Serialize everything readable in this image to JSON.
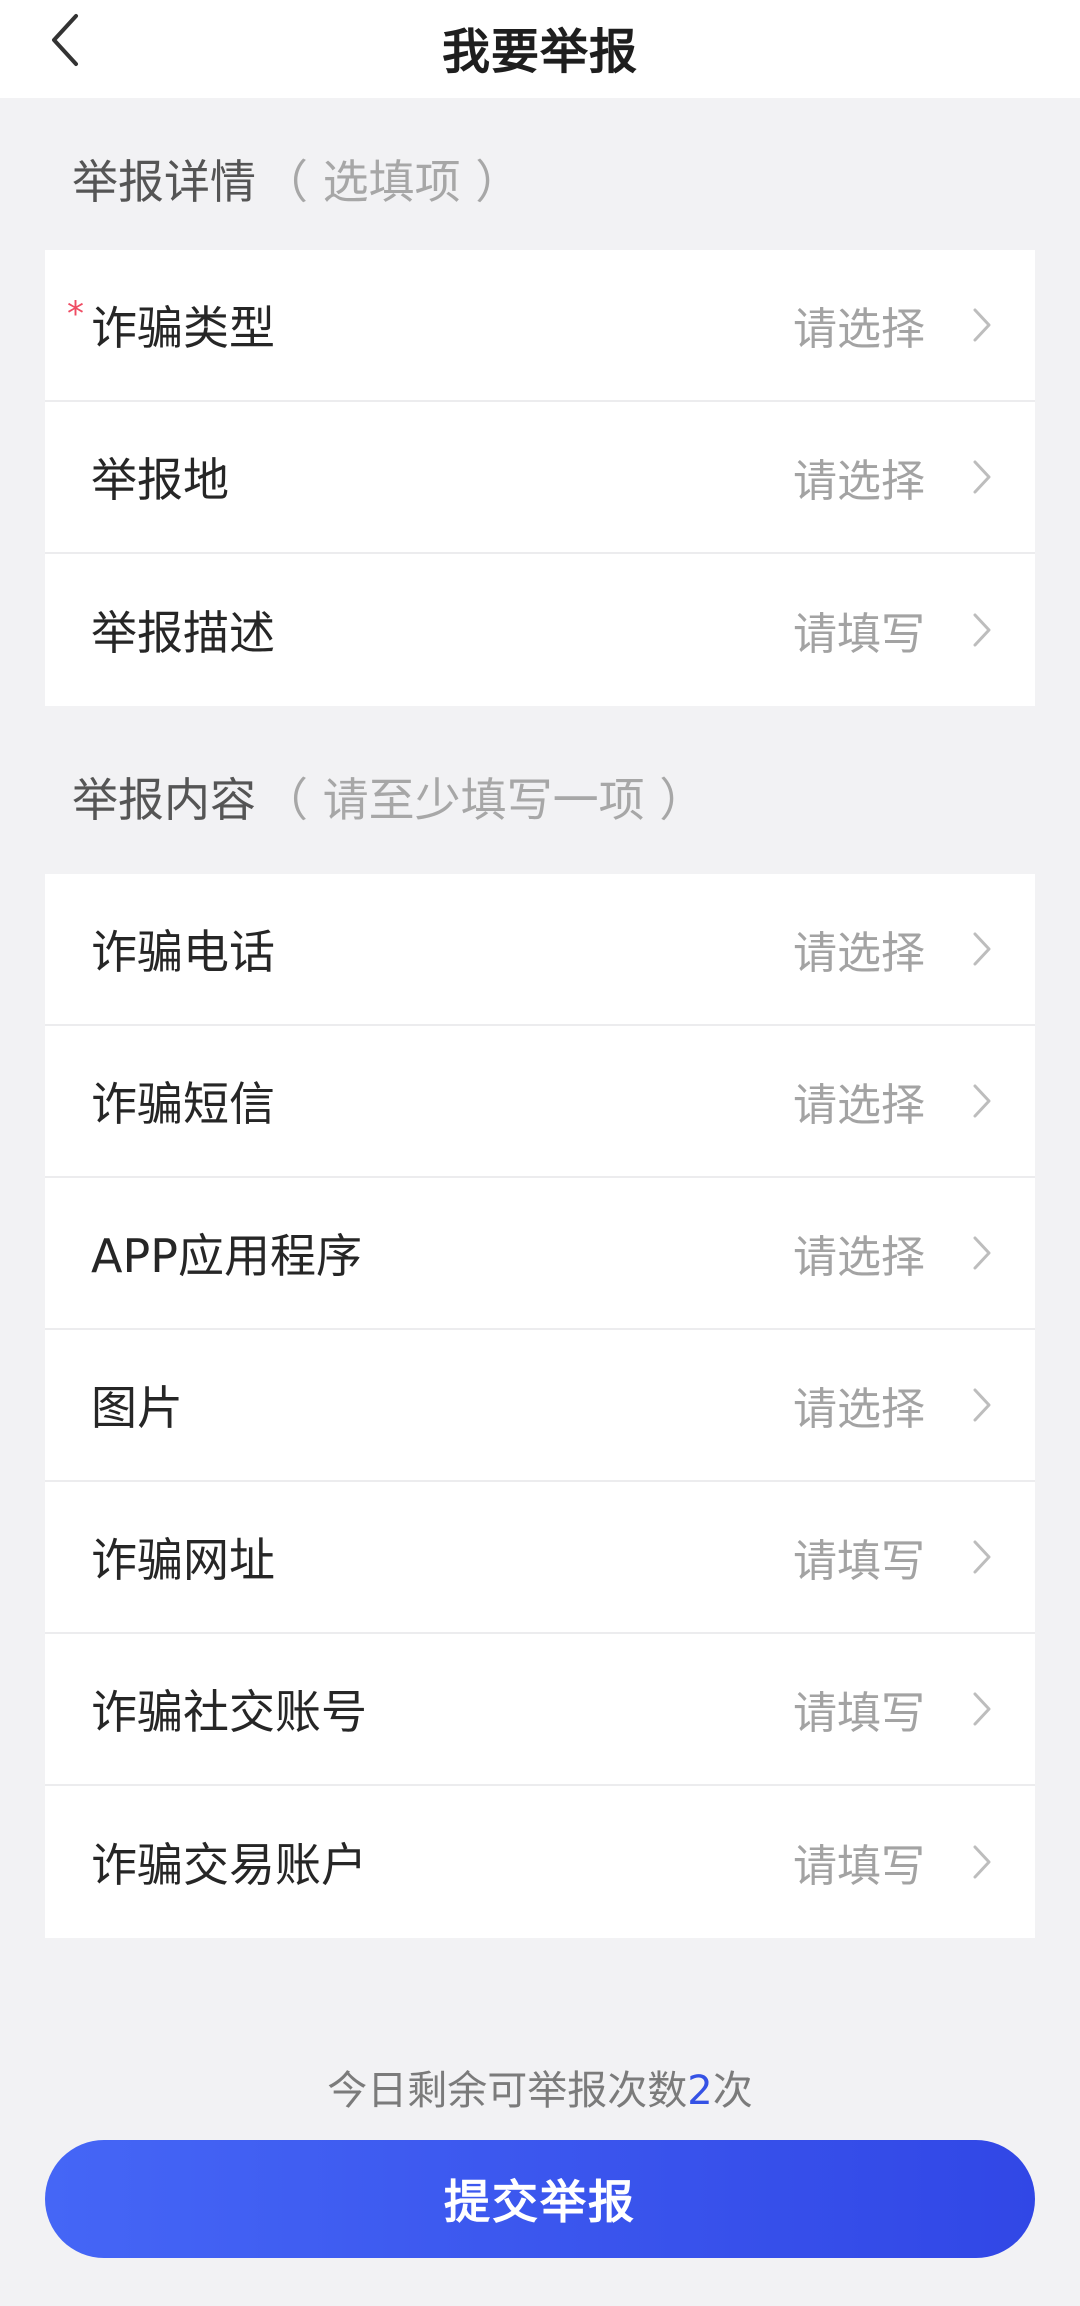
{
  "header": {
    "title": "我要举报"
  },
  "details_section": {
    "title": "举报详情",
    "hint": "（ 选填项 ）",
    "required_mark": "*",
    "rows": [
      {
        "label": "诈骗类型",
        "value": "请选择",
        "required": true
      },
      {
        "label": "举报地",
        "value": "请选择",
        "required": false
      },
      {
        "label": "举报描述",
        "value": "请填写",
        "required": false
      }
    ]
  },
  "content_section": {
    "title": "举报内容",
    "hint": "（ 请至少填写一项 ）",
    "rows": [
      {
        "label": "诈骗电话",
        "value": "请选择"
      },
      {
        "label": "诈骗短信",
        "value": "请选择"
      },
      {
        "label": "APP应用程序",
        "value": "请选择"
      },
      {
        "label": "图片",
        "value": "请选择"
      },
      {
        "label": "诈骗网址",
        "value": "请填写"
      },
      {
        "label": "诈骗社交账号",
        "value": "请填写"
      },
      {
        "label": "诈骗交易账户",
        "value": "请填写"
      }
    ]
  },
  "footer": {
    "remaining_prefix": "今日剩余可举报次数",
    "remaining_count": "2",
    "remaining_suffix": "次",
    "submit_label": "提交举报"
  },
  "colors": {
    "accent": "#3552e5",
    "required": "#ef4c63",
    "background": "#f2f2f4"
  },
  "icons": {
    "back": "chevron-left-icon",
    "row_arrow": "chevron-right-icon"
  }
}
